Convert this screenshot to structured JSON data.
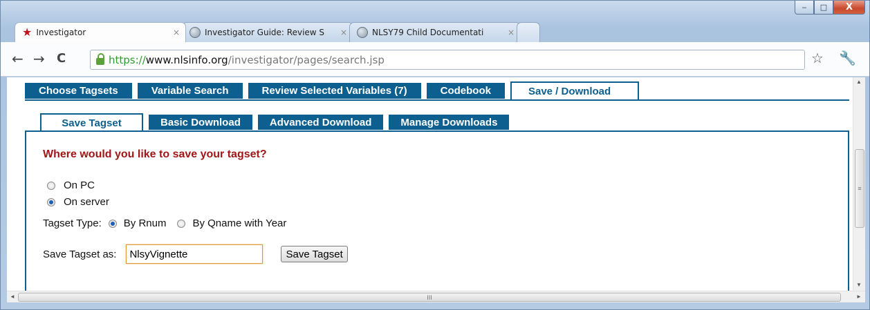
{
  "window": {
    "minimize_glyph": "‒",
    "maximize_glyph": "□",
    "close_glyph": "X"
  },
  "browser_tabs": [
    {
      "title": "Investigator",
      "icon": "star-icon",
      "active": true
    },
    {
      "title": "Investigator Guide: Review S",
      "icon": "globe-icon",
      "active": false
    },
    {
      "title": "NLSY79 Child Documentati",
      "icon": "globe-icon",
      "active": false
    }
  ],
  "tab_close_glyph": "×",
  "toolbar": {
    "back_glyph": "←",
    "forward_glyph": "→",
    "reload_glyph": "C",
    "url_scheme": "https://",
    "url_host": "www.nlsinfo.org",
    "url_path": "/investigator/pages/search.jsp",
    "bookmark_glyph": "☆",
    "wrench_glyph": "🔧"
  },
  "main_tabs": [
    "Choose Tagsets",
    "Variable Search",
    "Review Selected Variables (7)",
    "Codebook",
    "Save / Download"
  ],
  "main_tab_active": "Save / Download",
  "sub_tabs": [
    "Save Tagset",
    "Basic Download",
    "Advanced Download",
    "Manage Downloads"
  ],
  "sub_tab_active": "Save Tagset",
  "form": {
    "question": "Where would you like to save your tagset?",
    "location_options": [
      {
        "label": "On PC",
        "checked": false
      },
      {
        "label": "On server",
        "checked": true
      }
    ],
    "tagset_type_label": "Tagset Type:",
    "tagset_type_options": [
      {
        "label": "By Rnum",
        "checked": true
      },
      {
        "label": "By Qname with Year",
        "checked": false
      }
    ],
    "save_as_label": "Save Tagset as:",
    "save_as_value": "NlsyVignette",
    "save_button": "Save Tagset"
  },
  "scrollbar": {
    "grip_glyph": "≡",
    "h_grip_glyph": "III",
    "up_glyph": "▲",
    "down_glyph": "▼",
    "left_glyph": "◄",
    "right_glyph": "►"
  }
}
